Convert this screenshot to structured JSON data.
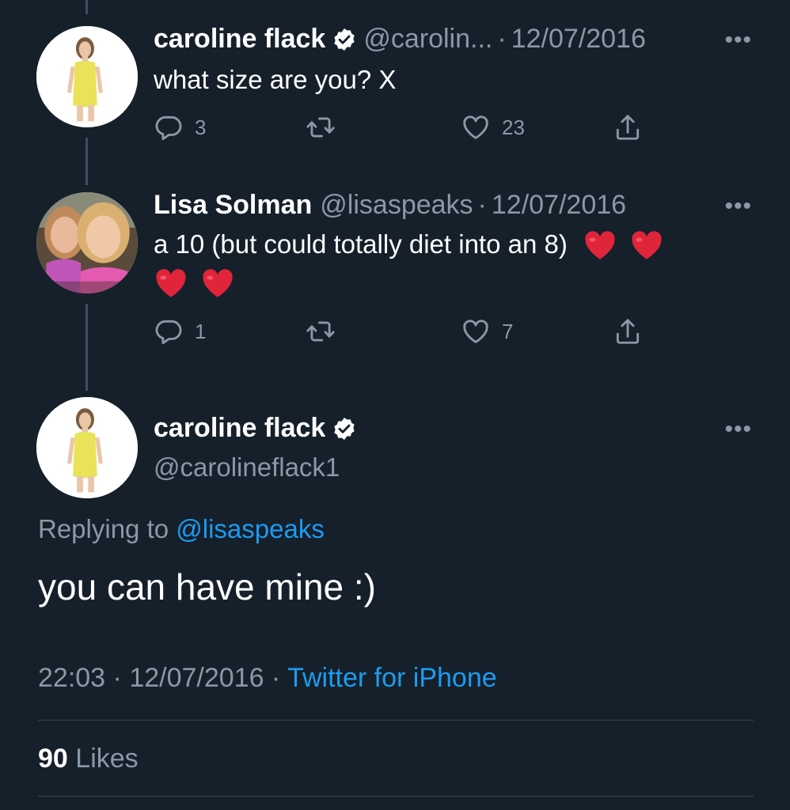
{
  "colors": {
    "background": "#15202b",
    "text": "#ffffff",
    "muted": "#8b98a5",
    "link": "#1d9bf0"
  },
  "tweet1": {
    "name": "caroline flack",
    "handle": "@carolin...",
    "dot": "·",
    "date": "12/07/2016",
    "more": "•••",
    "text": "what size are you? X",
    "replies": "3",
    "likes": "23"
  },
  "tweet2": {
    "name": "Lisa Solman",
    "handle": "@lisaspeaks",
    "dot": "·",
    "date": "12/07/2016",
    "more": "•••",
    "text": "a 10 (but could totally diet into an 8)",
    "replies": "1",
    "likes": "7"
  },
  "main": {
    "name": "caroline flack",
    "handle": "@carolineflack1",
    "more": "•••",
    "replying_prefix": "Replying to ",
    "replying_to": "@lisaspeaks",
    "text": "you can have mine :)",
    "time": "22:03",
    "dot1": " · ",
    "date": "12/07/2016",
    "dot2": " · ",
    "source": "Twitter for iPhone",
    "likes_count": "90",
    "likes_label": "Likes"
  },
  "icons": [
    "reply-icon",
    "retweet-icon",
    "like-icon",
    "share-icon",
    "verified-badge-icon",
    "more-icon",
    "red-heart-emoji"
  ]
}
